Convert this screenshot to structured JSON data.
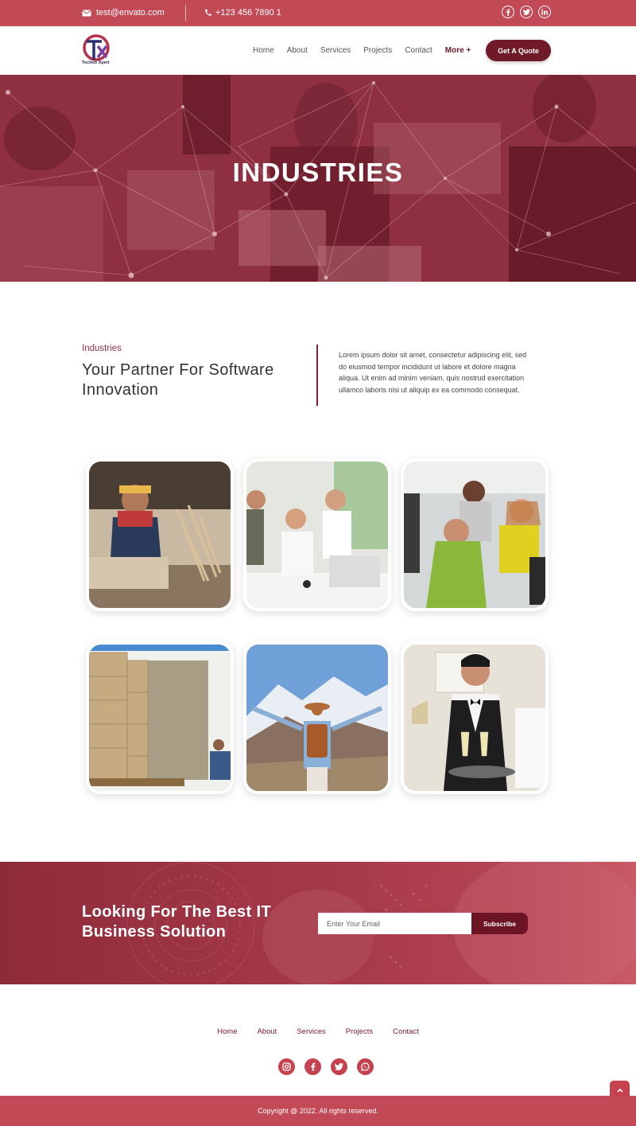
{
  "topbar": {
    "email": "test@envato.com",
    "phone": "+123 456 7890 1",
    "socials": [
      "facebook-icon",
      "twitter-icon",
      "linkedin-icon"
    ]
  },
  "brand": {
    "name": "Techno Xpert",
    "logo_letters": "TX"
  },
  "nav": {
    "items": [
      "Home",
      "About",
      "Services",
      "Projects",
      "Contact"
    ],
    "more_label": "More +",
    "cta_label": "Get A Quote"
  },
  "hero": {
    "title": "INDUSTRIES"
  },
  "intro": {
    "kicker": "Industries",
    "title": "Your Partner For Software Innovation",
    "body": "Lorem ipsum dolor sit amet, consectetur adipiscing elit, sed do eiusmod tempor incididunt ut labore et dolore magna aliqua. Ut enim ad minim veniam, quis nostrud exercitation ullamco laboris nisi ut aliquip ex ea commodo consequat."
  },
  "industries": [
    "woodworking-photo",
    "office-team-photo",
    "computer-lab-photo",
    "logistics-truck-photo",
    "travel-mountains-photo",
    "hospitality-waiter-photo"
  ],
  "subscribe": {
    "title": "Looking For The Best IT Business Solution",
    "placeholder": "Enter Your Email",
    "button": "Subscribe"
  },
  "footer": {
    "links": [
      "Home",
      "About",
      "Services",
      "Projects",
      "Contact"
    ],
    "socials": [
      "instagram-icon",
      "facebook-icon",
      "twitter-icon",
      "whatsapp-icon"
    ],
    "copyright": "Copyright @ 2022. All rights reserved."
  },
  "colors": {
    "primary": "#c24a56",
    "dark": "#701a28",
    "text": "#333333"
  }
}
